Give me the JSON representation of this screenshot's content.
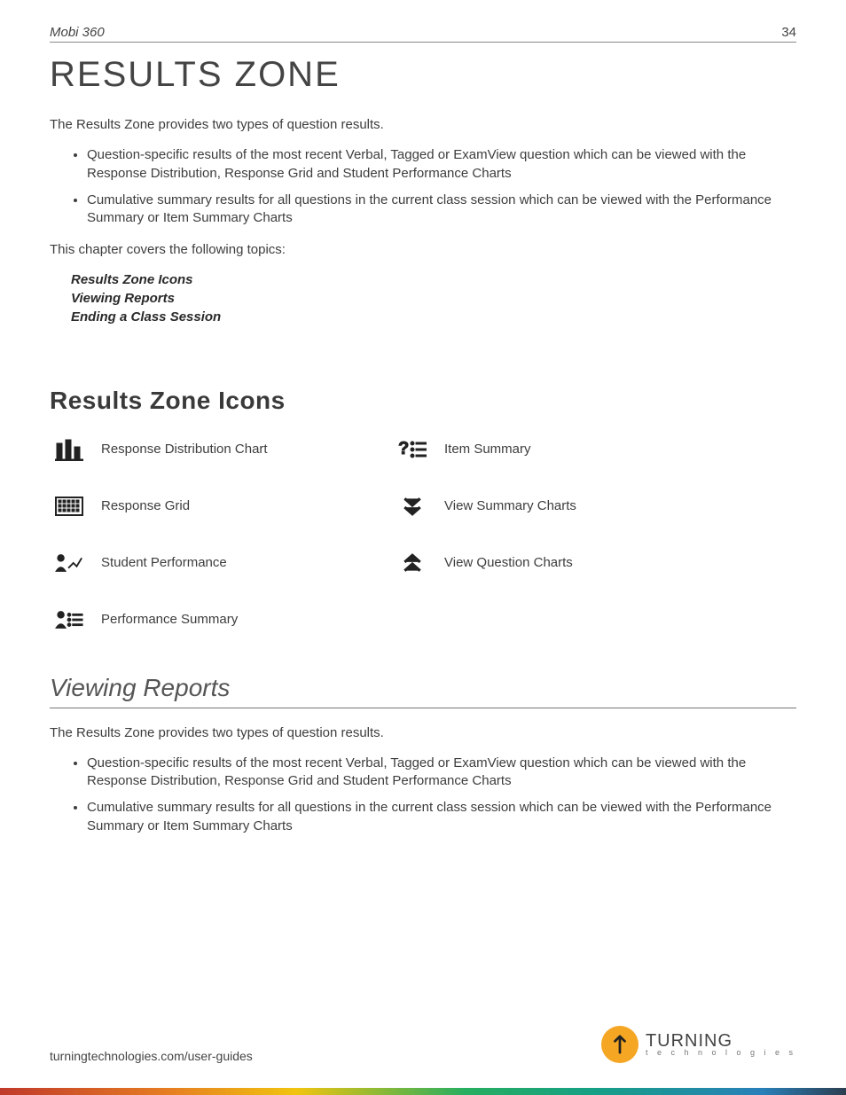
{
  "header": {
    "product": "Mobi 360",
    "page_number": "34"
  },
  "title": "RESULTS ZONE",
  "intro1": "The Results Zone provides two types of question results.",
  "bullets1": [
    "Question-specific results of the most recent Verbal, Tagged or ExamView question which can be viewed with the Response Distribution, Response Grid and Student Performance Charts",
    "Cumulative summary results for all questions in the current class session which can be viewed with the Performance Summary or Item Summary Charts"
  ],
  "topics_intro": "This chapter covers the following topics:",
  "topics": {
    "t1": "Results Zone Icons",
    "t2": "Viewing Reports",
    "t3": "Ending a Class Session"
  },
  "section_icons_heading": "Results Zone Icons",
  "icons": {
    "response_distribution": "Response Distribution Chart",
    "item_summary": "Item Summary",
    "response_grid": "Response Grid",
    "view_summary": "View Summary Charts",
    "student_performance": "Student Performance",
    "view_question": "View Question Charts",
    "performance_summary": "Performance Summary"
  },
  "section_viewing_heading": "Viewing Reports",
  "intro2": "The Results Zone provides two types of question results.",
  "bullets2": [
    "Question-specific results of the most recent Verbal, Tagged or ExamView question which can be viewed with the Response Distribution, Response Grid and Student Performance Charts",
    "Cumulative summary results for all questions in the current class session which can be viewed with the Performance Summary or Item Summary Charts"
  ],
  "footer": {
    "url": "turningtechnologies.com/user-guides",
    "brand_line1": "TURNING",
    "brand_line2": "t e c h n o l o g i e s"
  }
}
